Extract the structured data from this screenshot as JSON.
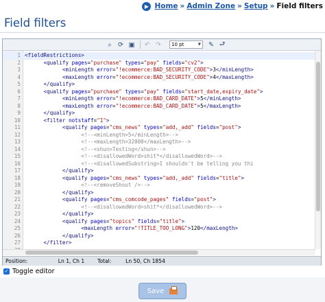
{
  "breadcrumb": {
    "icon": "go-icon",
    "items": [
      "Home",
      "Admin Zone",
      "Setup"
    ],
    "separator": "»",
    "current": "Field filters"
  },
  "page": {
    "title": "Field filters"
  },
  "toolbar": {
    "buttons": [
      "binoculars-icon",
      "refresh-icon",
      "fullscreen-icon",
      "undo-icon",
      "redo-icon"
    ],
    "font_size": "10 pt",
    "extra_buttons": [
      "eraser-icon",
      "word-wrap-icon"
    ]
  },
  "code_lines": [
    {
      "n": "1",
      "indent": "",
      "html": "<span class='tag'>&lt;fieldRestrictions&gt;</span>"
    },
    {
      "n": "2",
      "indent": "      ",
      "html": "<span class='tag'>&lt;qualify</span> <span class='attr'>pages</span>=<span class='val'>\"purchase\"</span> <span class='attr'>types</span>=<span class='val'>\"pay\"</span> <span class='attr'>fields</span>=<span class='val'>\"cv2\"</span><span class='tag'>&gt;</span>"
    },
    {
      "n": "3",
      "indent": "            ",
      "html": "<span class='tag'>&lt;minLength</span> <span class='attr'>error</span>=<span class='val'>\"!ecommerce:BAD_SECURITY_CODE\"</span><span class='tag'>&gt;</span><span class='txt'>3</span><span class='tag'>&lt;/minLength&gt;</span>"
    },
    {
      "n": "4",
      "indent": "            ",
      "html": "<span class='tag'>&lt;maxLength</span> <span class='attr'>error</span>=<span class='val'>\"!ecommerce:BAD_SECURITY_CODE\"</span><span class='tag'>&gt;</span><span class='txt'>4</span><span class='tag'>&lt;/maxLength&gt;</span>"
    },
    {
      "n": "5",
      "indent": "      ",
      "html": "<span class='tag'>&lt;/qualify&gt;</span>"
    },
    {
      "n": "6",
      "indent": "      ",
      "html": "<span class='tag'>&lt;qualify</span> <span class='attr'>pages</span>=<span class='val'>\"purchase\"</span> <span class='attr'>types</span>=<span class='val'>\"pay\"</span> <span class='attr'>fields</span>=<span class='val'>\"start_date,expiry_date\"</span><span class='tag'>&gt;</span>"
    },
    {
      "n": "7",
      "indent": "            ",
      "html": "<span class='tag'>&lt;minLength</span> <span class='attr'>error</span>=<span class='val'>\"!ecommerce:BAD_CARD_DATE\"</span><span class='tag'>&gt;</span><span class='txt'>5</span><span class='tag'>&lt;/minLength&gt;</span>"
    },
    {
      "n": "8",
      "indent": "            ",
      "html": "<span class='tag'>&lt;maxLength</span> <span class='attr'>error</span>=<span class='val'>\"!ecommerce:BAD_CARD_DATE\"</span><span class='tag'>&gt;</span><span class='txt'>5</span><span class='tag'>&lt;/maxLength&gt;</span>"
    },
    {
      "n": "9",
      "indent": "      ",
      "html": "<span class='tag'>&lt;/qualify&gt;</span>"
    },
    {
      "n": "10",
      "indent": "      ",
      "html": "<span class='tag'>&lt;filter</span> <span class='attr'>notstaff</span>=<span class='val'>\"1\"</span><span class='tag'>&gt;</span>"
    },
    {
      "n": "11",
      "indent": "            ",
      "html": "<span class='tag'>&lt;qualify</span> <span class='attr'>pages</span>=<span class='val'>\"cms_news\"</span> <span class='attr'>types</span>=<span class='val'>\"add,_add\"</span> <span class='attr'>fields</span>=<span class='val'>\"post\"</span><span class='tag'>&gt;</span>"
    },
    {
      "n": "12",
      "indent": "                  ",
      "html": "<span class='cmt'>&lt;!--&lt;minLength&gt;5&lt;/minLength&gt;--&gt;</span>"
    },
    {
      "n": "13",
      "indent": "                  ",
      "html": "<span class='cmt'>&lt;!--&lt;maxLength&gt;32000&lt;/maxLength&gt;--&gt;</span>"
    },
    {
      "n": "14",
      "indent": "                  ",
      "html": "<span class='cmt'>&lt;!--&lt;shun&gt;Testing&lt;/shun&gt;--&gt;</span>"
    },
    {
      "n": "15",
      "indent": "                  ",
      "html": "<span class='cmt'>&lt;!--&lt;disallowedWord&gt;shit*&lt;/disallowedWord&gt;--&gt;</span>"
    },
    {
      "n": "16",
      "indent": "                  ",
      "html": "<span class='cmt'>&lt;!--&lt;disallowedSubstring&gt;I shouldn't be telling you thi</span>"
    },
    {
      "n": "17",
      "indent": "            ",
      "html": "<span class='tag'>&lt;/qualify&gt;</span>"
    },
    {
      "n": "18",
      "indent": "            ",
      "html": "<span class='tag'>&lt;qualify</span> <span class='attr'>pages</span>=<span class='val'>\"cms_news\"</span> <span class='attr'>types</span>=<span class='val'>\"add,_add\"</span> <span class='attr'>fields</span>=<span class='val'>\"title\"</span><span class='tag'>&gt;</span>"
    },
    {
      "n": "19",
      "indent": "                  ",
      "html": "<span class='cmt'>&lt;!--&lt;removeShout /&gt;--&gt;</span>"
    },
    {
      "n": "20",
      "indent": "            ",
      "html": "<span class='tag'>&lt;/qualify&gt;</span>"
    },
    {
      "n": "21",
      "indent": "            ",
      "html": "<span class='tag'>&lt;qualify</span> <span class='attr'>pages</span>=<span class='val'>\"cms_comcode_pages\"</span> <span class='attr'>fields</span>=<span class='val'>\"post\"</span><span class='tag'>&gt;</span>"
    },
    {
      "n": "22",
      "indent": "                  ",
      "html": "<span class='cmt'>&lt;!--&lt;disallowedWord&gt;shit*&lt;/disallowedWord&gt;--&gt;</span>"
    },
    {
      "n": "23",
      "indent": "            ",
      "html": "<span class='tag'>&lt;/qualify&gt;</span>"
    },
    {
      "n": "24",
      "indent": "            ",
      "html": "<span class='tag'>&lt;qualify</span> <span class='attr'>pages</span>=<span class='val'>\"topics\"</span> <span class='attr'>fields</span>=<span class='val'>\"title\"</span><span class='tag'>&gt;</span>"
    },
    {
      "n": "25",
      "indent": "                  ",
      "html": "<span class='tag'>&lt;maxLength</span> <span class='attr'>error</span>=<span class='val'>\"!TITLE_TOO_LONG\"</span><span class='tag'>&gt;</span><span class='txt'>120</span><span class='tag'>&lt;/maxLength&gt;</span>"
    },
    {
      "n": "26",
      "indent": "            ",
      "html": "<span class='tag'>&lt;/qualify&gt;</span>"
    },
    {
      "n": "27",
      "indent": "      ",
      "html": "<span class='tag'>&lt;/filter&gt;</span>"
    },
    {
      "n": "28",
      "indent": "",
      "html": ""
    }
  ],
  "status": {
    "position_label": "Position:",
    "position_value": "Ln 1, Ch 1",
    "total_label": "Total:",
    "total_value": "Ln 50, Ch 1854"
  },
  "toggle": {
    "label": "Toggle editor",
    "checked": true
  },
  "save": {
    "label": "Save"
  },
  "colors": {
    "accent": "#1e4f93",
    "link": "#1c58a8",
    "save_bg": "#a9c3e6"
  }
}
